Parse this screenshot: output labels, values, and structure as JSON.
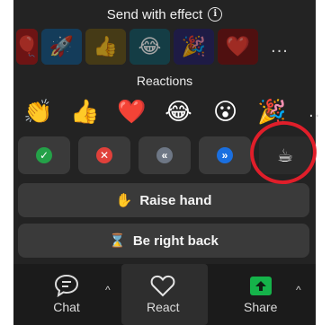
{
  "popup": {
    "title": "Send with effect",
    "effects": [
      {
        "icon": "balloon-icon",
        "emoji": "🎈",
        "bg": "#a81f1f"
      },
      {
        "icon": "rocket-icon",
        "emoji": "🚀",
        "bg": "#1f5c8a"
      },
      {
        "icon": "thumbs-up-icon",
        "emoji": "👍",
        "bg": "#6b5a22"
      },
      {
        "icon": "laughing-face-icon",
        "emoji": "😂",
        "bg": "#1f5f6b"
      },
      {
        "icon": "party-popper-icon",
        "emoji": "🎉",
        "bg": "#2e2a6b"
      },
      {
        "icon": "heart-icon",
        "emoji": "❤️",
        "bg": "#7a1a1a"
      }
    ],
    "more_label": "...",
    "reactions_label": "Reactions",
    "reactions": [
      {
        "icon": "clapping-hands-icon",
        "emoji": "👏"
      },
      {
        "icon": "thumbs-up-icon",
        "emoji": "👍"
      },
      {
        "icon": "heart-icon",
        "emoji": "❤️"
      },
      {
        "icon": "laughing-face-icon",
        "emoji": "😂"
      },
      {
        "icon": "surprised-face-icon",
        "emoji": "😮"
      },
      {
        "icon": "party-popper-icon",
        "emoji": "🎉"
      }
    ],
    "status_buttons": [
      {
        "name": "yes-button",
        "icon": "check-icon",
        "glyph": "✓",
        "color": "#24a148"
      },
      {
        "name": "no-button",
        "icon": "x-icon",
        "glyph": "✕",
        "color": "#e0403a"
      },
      {
        "name": "slower-button",
        "icon": "rewind-icon",
        "glyph": "«",
        "color": "#6e7785"
      },
      {
        "name": "faster-button",
        "icon": "fast-forward-icon",
        "glyph": "»",
        "color": "#1a6fe0"
      },
      {
        "name": "coffee-button",
        "icon": "coffee-cup-icon",
        "glyph": "☕",
        "color": "#ffffff"
      }
    ],
    "raise_hand_label": "Raise hand",
    "raise_hand_icon": "✋",
    "be_right_back_label": "Be right back",
    "be_right_back_icon": "⌛",
    "annotation_color": "#e01e2a"
  },
  "toolbar": {
    "chat_label": "Chat",
    "react_label": "React",
    "share_label": "Share",
    "caret": "^",
    "share_color": "#15b34a"
  }
}
